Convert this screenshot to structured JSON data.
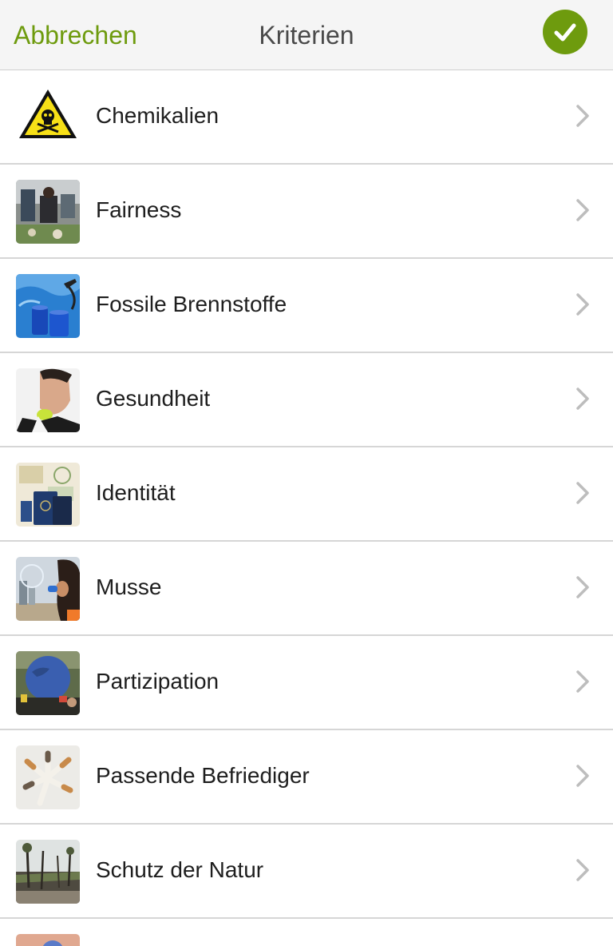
{
  "header": {
    "cancel_label": "Abbrechen",
    "title": "Kriterien",
    "confirm_icon": "check-icon"
  },
  "items": [
    {
      "label": "Chemikalien",
      "icon": "toxic-warning-icon"
    },
    {
      "label": "Fairness",
      "icon": "fairness-photo"
    },
    {
      "label": "Fossile Brennstoffe",
      "icon": "fossil-fuels-photo"
    },
    {
      "label": "Gesundheit",
      "icon": "health-photo"
    },
    {
      "label": "Identität",
      "icon": "identity-photo"
    },
    {
      "label": "Musse",
      "icon": "leisure-photo"
    },
    {
      "label": "Partizipation",
      "icon": "participation-photo"
    },
    {
      "label": "Passende Befriediger",
      "icon": "cigarettes-photo"
    },
    {
      "label": "Schutz der Natur",
      "icon": "nature-photo"
    }
  ],
  "colors": {
    "accent": "#6e9b0e",
    "header_bg": "#f5f5f5",
    "divider": "#d6d6d6",
    "chevron": "#bdbdbd"
  }
}
